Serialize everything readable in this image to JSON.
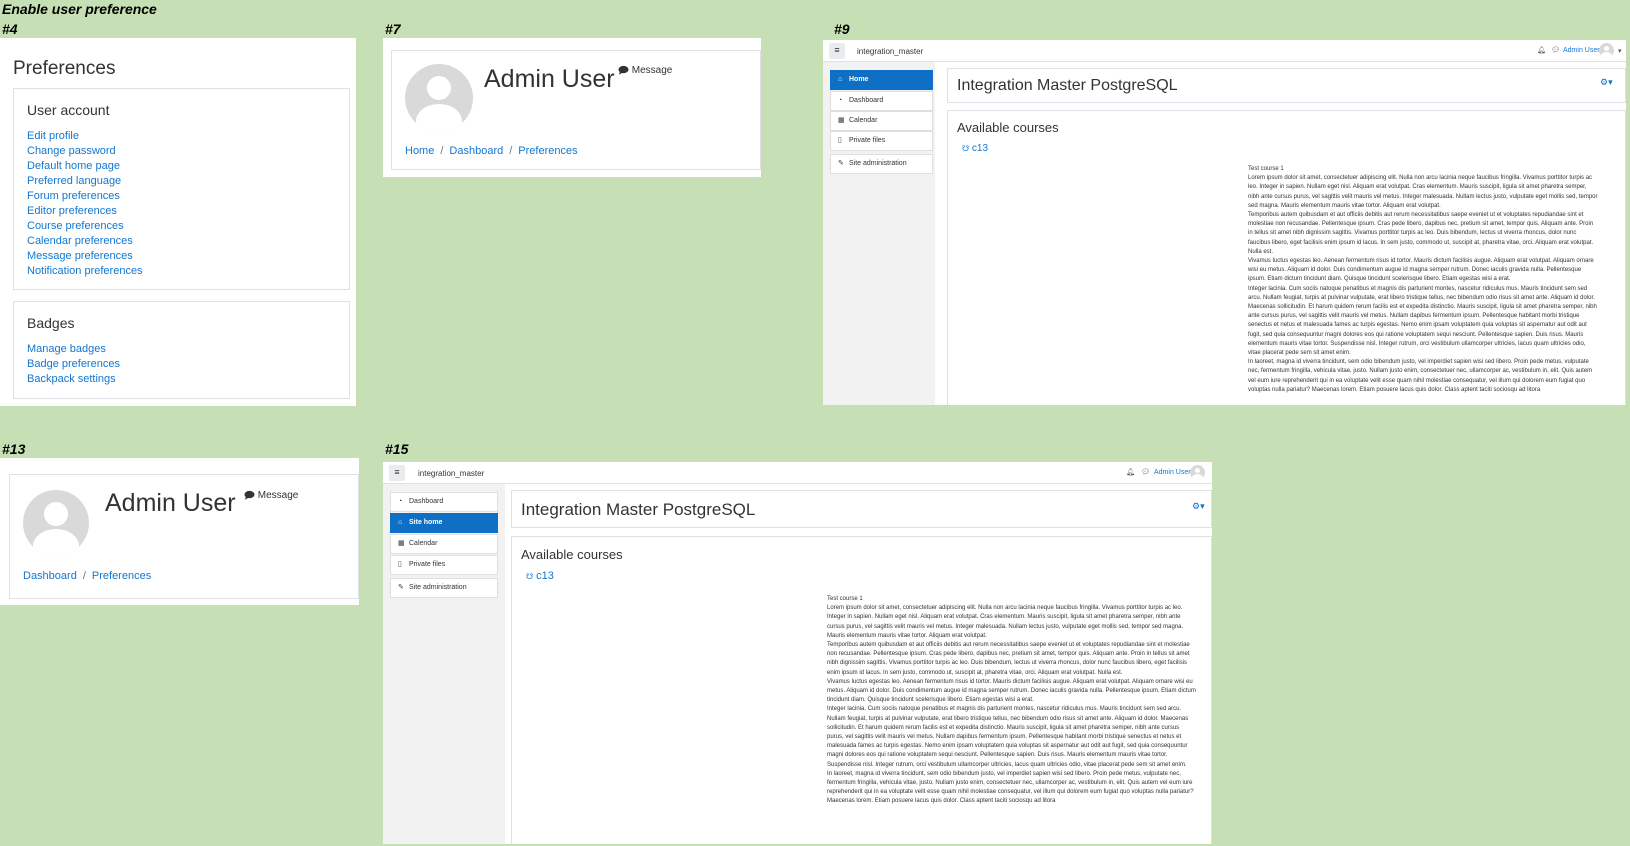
{
  "page_title": "Enable user preference",
  "labels": {
    "s4": "#4",
    "s7": "#7",
    "s9": "#9",
    "s13": "#13",
    "s15": "#15"
  },
  "preferences": {
    "title": "Preferences",
    "user_account": {
      "heading": "User account",
      "links": [
        "Edit profile",
        "Change password",
        "Default home page",
        "Preferred language",
        "Forum preferences",
        "Editor preferences",
        "Course preferences",
        "Calendar preferences",
        "Message preferences",
        "Notification preferences"
      ]
    },
    "badges": {
      "heading": "Badges",
      "links": [
        "Manage badges",
        "Badge preferences",
        "Backpack settings"
      ]
    }
  },
  "profile7": {
    "name": "Admin User",
    "message": "Message",
    "breadcrumb": [
      "Home",
      "Dashboard",
      "Preferences"
    ]
  },
  "profile13": {
    "name": "Admin User",
    "message": "Message",
    "breadcrumb": [
      "Dashboard",
      "Preferences"
    ]
  },
  "site9": {
    "site_name": "integration_master",
    "user_name": "Admin User",
    "nav": [
      {
        "label": "Home",
        "icon": "home-icon",
        "active": true
      },
      {
        "label": "Dashboard",
        "icon": "dashboard-icon",
        "active": false
      },
      {
        "label": "Calendar",
        "icon": "calendar-icon",
        "active": false
      },
      {
        "label": "Private files",
        "icon": "file-icon",
        "active": false
      }
    ],
    "site_admin": "Site administration",
    "heading": "Integration Master PostgreSQL",
    "available_courses": "Available courses",
    "course_link": "c13"
  },
  "site15": {
    "site_name": "integration_master",
    "user_name": "Admin User",
    "nav": [
      {
        "label": "Dashboard",
        "icon": "dashboard-icon",
        "active": false
      },
      {
        "label": "Site home",
        "icon": "home-icon",
        "active": true
      },
      {
        "label": "Calendar",
        "icon": "calendar-icon",
        "active": false
      },
      {
        "label": "Private files",
        "icon": "file-icon",
        "active": false
      }
    ],
    "site_admin": "Site administration",
    "heading": "Integration Master PostgreSQL",
    "available_courses": "Available courses",
    "course_link": "c13"
  },
  "course_summary": {
    "title": "Test course 1",
    "paragraphs": [
      "Lorem ipsum dolor sit amet, consectetuer adipiscing elit. Nulla non arcu lacinia neque faucibus fringilla. Vivamus porttitor turpis ac leo. Integer in sapien. Nullam eget nisl. Aliquam erat volutpat. Cras elementum. Mauris suscipit, ligula sit amet pharetra semper, nibh ante cursus purus, vel sagittis velit mauris vel metus. Integer malesuada. Nullam lectus justo, vulputate eget mollis sed, tempor sed magna. Mauris elementum mauris vitae tortor. Aliquam erat volutpat.",
      "Temporibus autem quibusdam et aut officiis debitis aut rerum necessitatibus saepe eveniet ut et voluptates repudiandae sint et molestiae non recusandae. Pellentesque ipsum. Cras pede libero, dapibus nec, pretium sit amet, tempor quis. Aliquam ante. Proin in tellus sit amet nibh dignissim sagittis. Vivamus porttitor turpis ac leo. Duis bibendum, lectus ut viverra rhoncus, dolor nunc faucibus libero, eget facilisis enim ipsum id lacus. In sem justo, commodo ut, suscipit at, pharetra vitae, orci. Aliquam erat volutpat. Nulla est.",
      "Vivamus luctus egestas leo. Aenean fermentum risus id tortor. Mauris dictum facilisis augue. Aliquam erat volutpat. Aliquam ornare wisi eu metus. Aliquam id dolor. Duis condimentum augue id magna semper rutrum. Donec iaculis gravida nulla. Pellentesque ipsum. Etiam dictum tincidunt diam. Quisque tincidunt scelerisque libero. Etiam egestas wisi a erat.",
      "Integer lacinia. Cum sociis natoque penatibus et magnis dis parturient montes, nascetur ridiculus mus. Mauris tincidunt sem sed arcu. Nullam feugiat, turpis at pulvinar vulputate, erat libero tristique tellus, nec bibendum odio risus sit amet ante. Aliquam id dolor. Maecenas sollicitudin. Et harum quidem rerum facilis est et expedita distinctio. Mauris suscipit, ligula sit amet pharetra semper, nibh ante cursus purus, vel sagittis velit mauris vel metus. Nullam dapibus fermentum ipsum. Pellentesque habitant morbi tristique senectus et netus et malesuada fames ac turpis egestas. Nemo enim ipsam voluptatem quia voluptas sit aspernatur aut odit aut fugit, sed quia consequuntur magni dolores eos qui ratione voluptatem sequi nesciunt. Pellentesque sapien. Duis risus. Mauris elementum mauris vitae tortor. Suspendisse nisl. Integer rutrum, orci vestibulum ullamcorper ultricies, lacus quam ultricies odio, vitae placerat pede sem sit amet enim.",
      "In laoreet, magna id viverra tincidunt, sem odio bibendum justo, vel imperdiet sapien wisi sed libero. Proin pede metus, vulputate nec, fermentum fringilla, vehicula vitae, justo. Nullam justo enim, consectetuer nec, ullamcorper ac, vestibulum in, elit. Quis autem vel eum iure reprehenderit qui in ea voluptate velit esse quam nihil molestiae consequatur, vel illum qui dolorem eum fugiat quo voluptas nulla pariatur? Maecenas lorem. Etiam posuere lacus quis dolor. Class aptent taciti sociosqu ad litora"
    ]
  },
  "colors": {
    "background": "#c6dfb4",
    "link": "#1177d1",
    "active_nav": "#0f6fc5"
  }
}
